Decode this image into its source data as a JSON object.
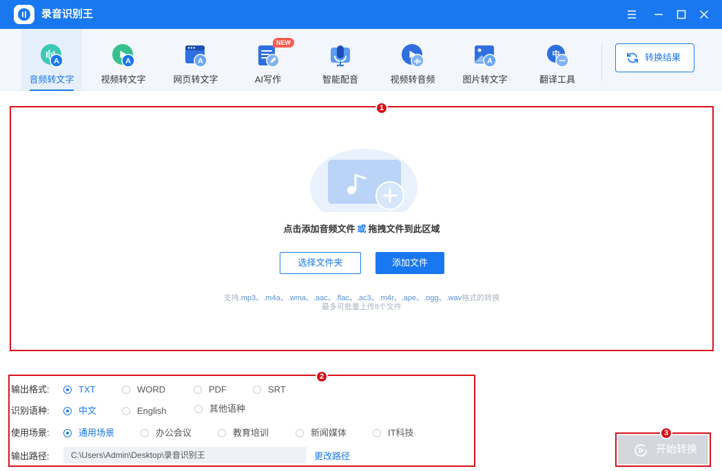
{
  "app": {
    "title": "录音识别王"
  },
  "toolbar": {
    "items": [
      {
        "label": "音频转文字",
        "icon": "audio-to-text-icon",
        "active": true
      },
      {
        "label": "视频转文字",
        "icon": "video-to-text-icon",
        "active": false
      },
      {
        "label": "网页转文字",
        "icon": "webpage-to-text-icon",
        "active": false
      },
      {
        "label": "AI写作",
        "icon": "ai-writing-icon",
        "active": false,
        "badge": "NEW"
      },
      {
        "label": "智能配音",
        "icon": "smart-dubbing-icon",
        "active": false
      },
      {
        "label": "视频转音频",
        "icon": "video-to-audio-icon",
        "active": false
      },
      {
        "label": "图片转文字",
        "icon": "image-to-text-icon",
        "active": false
      },
      {
        "label": "翻译工具",
        "icon": "translate-icon",
        "active": false
      }
    ],
    "result_button": "转换结果"
  },
  "dropzone": {
    "hint_part1": "点击添加音频文件",
    "hint_or": "或",
    "hint_part2": "拖拽文件到此区域",
    "select_folder": "选择文件夹",
    "add_file": "添加文件",
    "support_prefix": "支持",
    "support_formats": ".mp3、.m4a、.wma、.aac、.flac、.ac3、.m4r、.ape、.ogg、.wav",
    "support_suffix": "格式的转换",
    "limit": "最多可批量上传8个文件"
  },
  "options": {
    "format": {
      "label": "输出格式:",
      "choices": [
        "TXT",
        "WORD",
        "PDF",
        "SRT"
      ],
      "selected": "TXT"
    },
    "language": {
      "label": "识别语种:",
      "choices": [
        "中文",
        "English",
        "其他语种"
      ],
      "selected": "中文"
    },
    "scene": {
      "label": "使用场景:",
      "choices": [
        "通用场景",
        "办公会议",
        "教育培训",
        "新闻媒体",
        "IT科技"
      ],
      "selected": "通用场景"
    },
    "path": {
      "label": "输出路径:",
      "value": "C:\\Users\\Admin\\Desktop\\录音识别王",
      "change": "更改路径"
    }
  },
  "start_button": "开始转换",
  "markers": [
    "1",
    "2",
    "3"
  ],
  "colors": {
    "brand": "#1977f0",
    "highlight": "#d80f18",
    "disabled": "#d4d7dc"
  }
}
